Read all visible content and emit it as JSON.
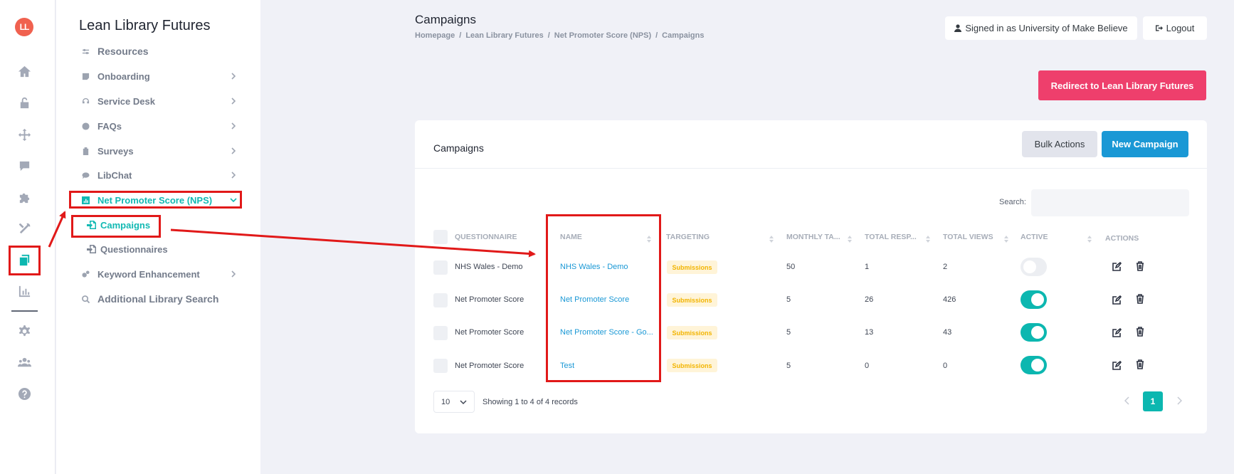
{
  "app": {
    "logo_text": "LL",
    "brand_color": "#0cb7b0",
    "accent_red": "#ee3f6c"
  },
  "rail": {
    "icons": [
      "home-icon",
      "unlock-icon",
      "move-icon",
      "comment-icon",
      "puzzle-icon",
      "tools-icon",
      "pages-icon",
      "chart-icon",
      "gear-icon",
      "users-icon",
      "help-icon"
    ],
    "active": "pages-icon"
  },
  "sidebar": {
    "title": "Lean Library Futures",
    "items": [
      {
        "label": "Resources",
        "icon": "sliders-icon"
      },
      {
        "label": "Onboarding",
        "icon": "note-icon"
      },
      {
        "label": "Service Desk",
        "icon": "headset-icon"
      },
      {
        "label": "FAQs",
        "icon": "question-icon"
      },
      {
        "label": "Surveys",
        "icon": "clipboard-icon"
      },
      {
        "label": "LibChat",
        "icon": "chat-icon"
      },
      {
        "label": "Net Promoter Score (NPS)",
        "icon": "chart-box-icon"
      },
      {
        "label": "Keyword Enhancement",
        "icon": "cogs-icon"
      },
      {
        "label": "Additional Library Search",
        "icon": "search-plus-icon"
      }
    ],
    "subitems": [
      {
        "label": "Campaigns",
        "icon": "file-import-icon"
      },
      {
        "label": "Questionnaires",
        "icon": "file-import-icon"
      }
    ]
  },
  "header": {
    "title": "Campaigns",
    "breadcrumb": [
      "Homepage",
      "Lean Library Futures",
      "Net Promoter Score (NPS)",
      "Campaigns"
    ],
    "signed_in": "Signed in as University of Make Believe",
    "logout": "Logout",
    "redirect": "Redirect to Lean Library Futures"
  },
  "card": {
    "title": "Campaigns",
    "bulk_actions": "Bulk Actions",
    "new_campaign": "New Campaign",
    "search_label": "Search:",
    "search_value": "",
    "columns": [
      "QUESTIONNAIRE",
      "NAME",
      "TARGETING",
      "MONTHLY TA...",
      "TOTAL RESP...",
      "TOTAL VIEWS",
      "ACTIVE",
      "ACTIONS"
    ],
    "rows": [
      {
        "questionnaire": "NHS Wales - Demo",
        "name": "NHS Wales - Demo",
        "targeting": "Submissions",
        "monthly": "50",
        "responses": "1",
        "views": "2",
        "active": false
      },
      {
        "questionnaire": "Net Promoter Score",
        "name": "Net Promoter Score",
        "targeting": "Submissions",
        "monthly": "5",
        "responses": "26",
        "views": "426",
        "active": true
      },
      {
        "questionnaire": "Net Promoter Score",
        "name": "Net Promoter Score - Go...",
        "targeting": "Submissions",
        "monthly": "5",
        "responses": "13",
        "views": "43",
        "active": true
      },
      {
        "questionnaire": "Net Promoter Score",
        "name": "Test",
        "targeting": "Submissions",
        "monthly": "5",
        "responses": "0",
        "views": "0",
        "active": true
      }
    ],
    "page_length": "10",
    "info": "Showing 1 to 4 of 4 records",
    "current_page": "1"
  },
  "annotation": {
    "color": "#e11919"
  }
}
